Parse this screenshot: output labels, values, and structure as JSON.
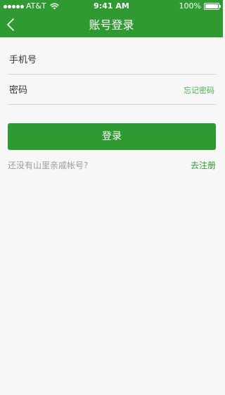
{
  "status_bar": {
    "carrier": "AT&T",
    "time": "9:41 AM",
    "battery": "100%",
    "battery_level": 1.0,
    "icons": [
      "signal-dots-icon",
      "wifi-icon",
      "battery-icon"
    ]
  },
  "nav": {
    "title": "账号登录",
    "back_icon": "chevron-left-icon"
  },
  "form": {
    "phone_placeholder": "手机号",
    "phone_value": "",
    "password_placeholder": "密码",
    "password_value": "",
    "forgot_label": "忘记密码"
  },
  "login_button": {
    "label": "登录"
  },
  "register": {
    "prompt": "还没有山里亲戚帐号?",
    "link_label": "去注册"
  },
  "colors": {
    "brand_green": "#2f9a32",
    "link_green": "#4caf50",
    "background": "#f7f7f7",
    "muted_text": "#9b9b9b"
  }
}
